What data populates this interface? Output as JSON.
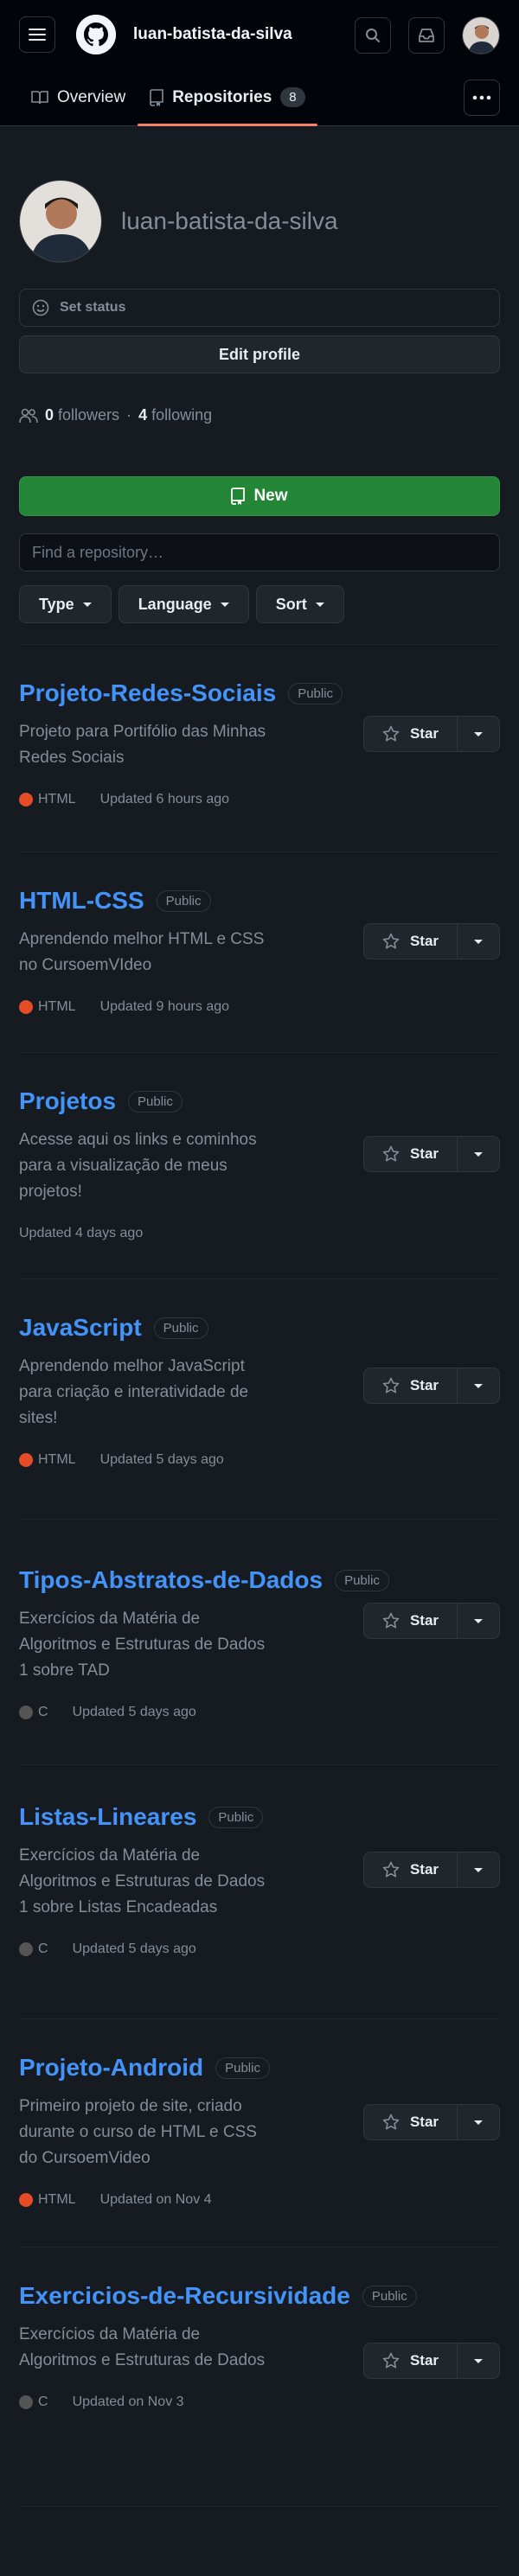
{
  "header": {
    "username": "luan-batista-da-silva"
  },
  "tabs": [
    {
      "label": "Overview"
    },
    {
      "label": "Repositories",
      "count": "8"
    }
  ],
  "profile": {
    "name": "luan-batista-da-silva",
    "set_status": "Set status",
    "edit_profile": "Edit profile",
    "followers_count": "0",
    "followers_label": "followers",
    "separator": "·",
    "following_count": "4",
    "following_label": "following"
  },
  "repo_controls": {
    "new_label": "New",
    "search_placeholder": "Find a repository…",
    "filters": [
      {
        "label": "Type"
      },
      {
        "label": "Language"
      },
      {
        "label": "Sort"
      }
    ]
  },
  "star_label": "Star",
  "colors": {
    "html": "#e34c26",
    "c": "#555555",
    "accent": "#4493f8",
    "new": "#238636",
    "tab_underline": "#f78166"
  },
  "repos": [
    {
      "name": "Projeto-Redes-Sociais",
      "visibility": "Public",
      "description": "Projeto para Portifólio das Minhas Redes Sociais",
      "language": "HTML",
      "updated": "Updated 6 hours ago"
    },
    {
      "name": "HTML-CSS",
      "visibility": "Public",
      "description": "Aprendendo melhor HTML e CSS no CursoemVIdeo",
      "language": "HTML",
      "updated": "Updated 9 hours ago"
    },
    {
      "name": "Projetos",
      "visibility": "Public",
      "description": "Acesse aqui os links e cominhos para a visualização de meus projetos!",
      "language": "",
      "updated": "Updated 4 days ago"
    },
    {
      "name": "JavaScript",
      "visibility": "Public",
      "description": "Aprendendo melhor JavaScript para criação e interatividade de sites!",
      "language": "HTML",
      "updated": "Updated 5 days ago"
    },
    {
      "name": "Tipos-Abstratos-de-Dados",
      "visibility": "Public",
      "description": "Exercícios da Matéria de Algoritmos e Estruturas de Dados 1 sobre TAD",
      "language": "C",
      "updated": "Updated 5 days ago"
    },
    {
      "name": "Listas-Lineares",
      "visibility": "Public",
      "description": "Exercícios da Matéria de Algoritmos e Estruturas de Dados 1 sobre Listas Encadeadas",
      "language": "C",
      "updated": "Updated 5 days ago"
    },
    {
      "name": "Projeto-Android",
      "visibility": "Public",
      "description": "Primeiro projeto de site, criado durante o curso de HTML e CSS do CursoemVideo",
      "language": "HTML",
      "updated": "Updated on Nov 4"
    },
    {
      "name": "Exercicios-de-Recursividade",
      "visibility": "Public",
      "description": "Exercícios da Matéria de Algoritmos e Estruturas de Dados",
      "language": "C",
      "updated": "Updated on Nov 3"
    }
  ]
}
